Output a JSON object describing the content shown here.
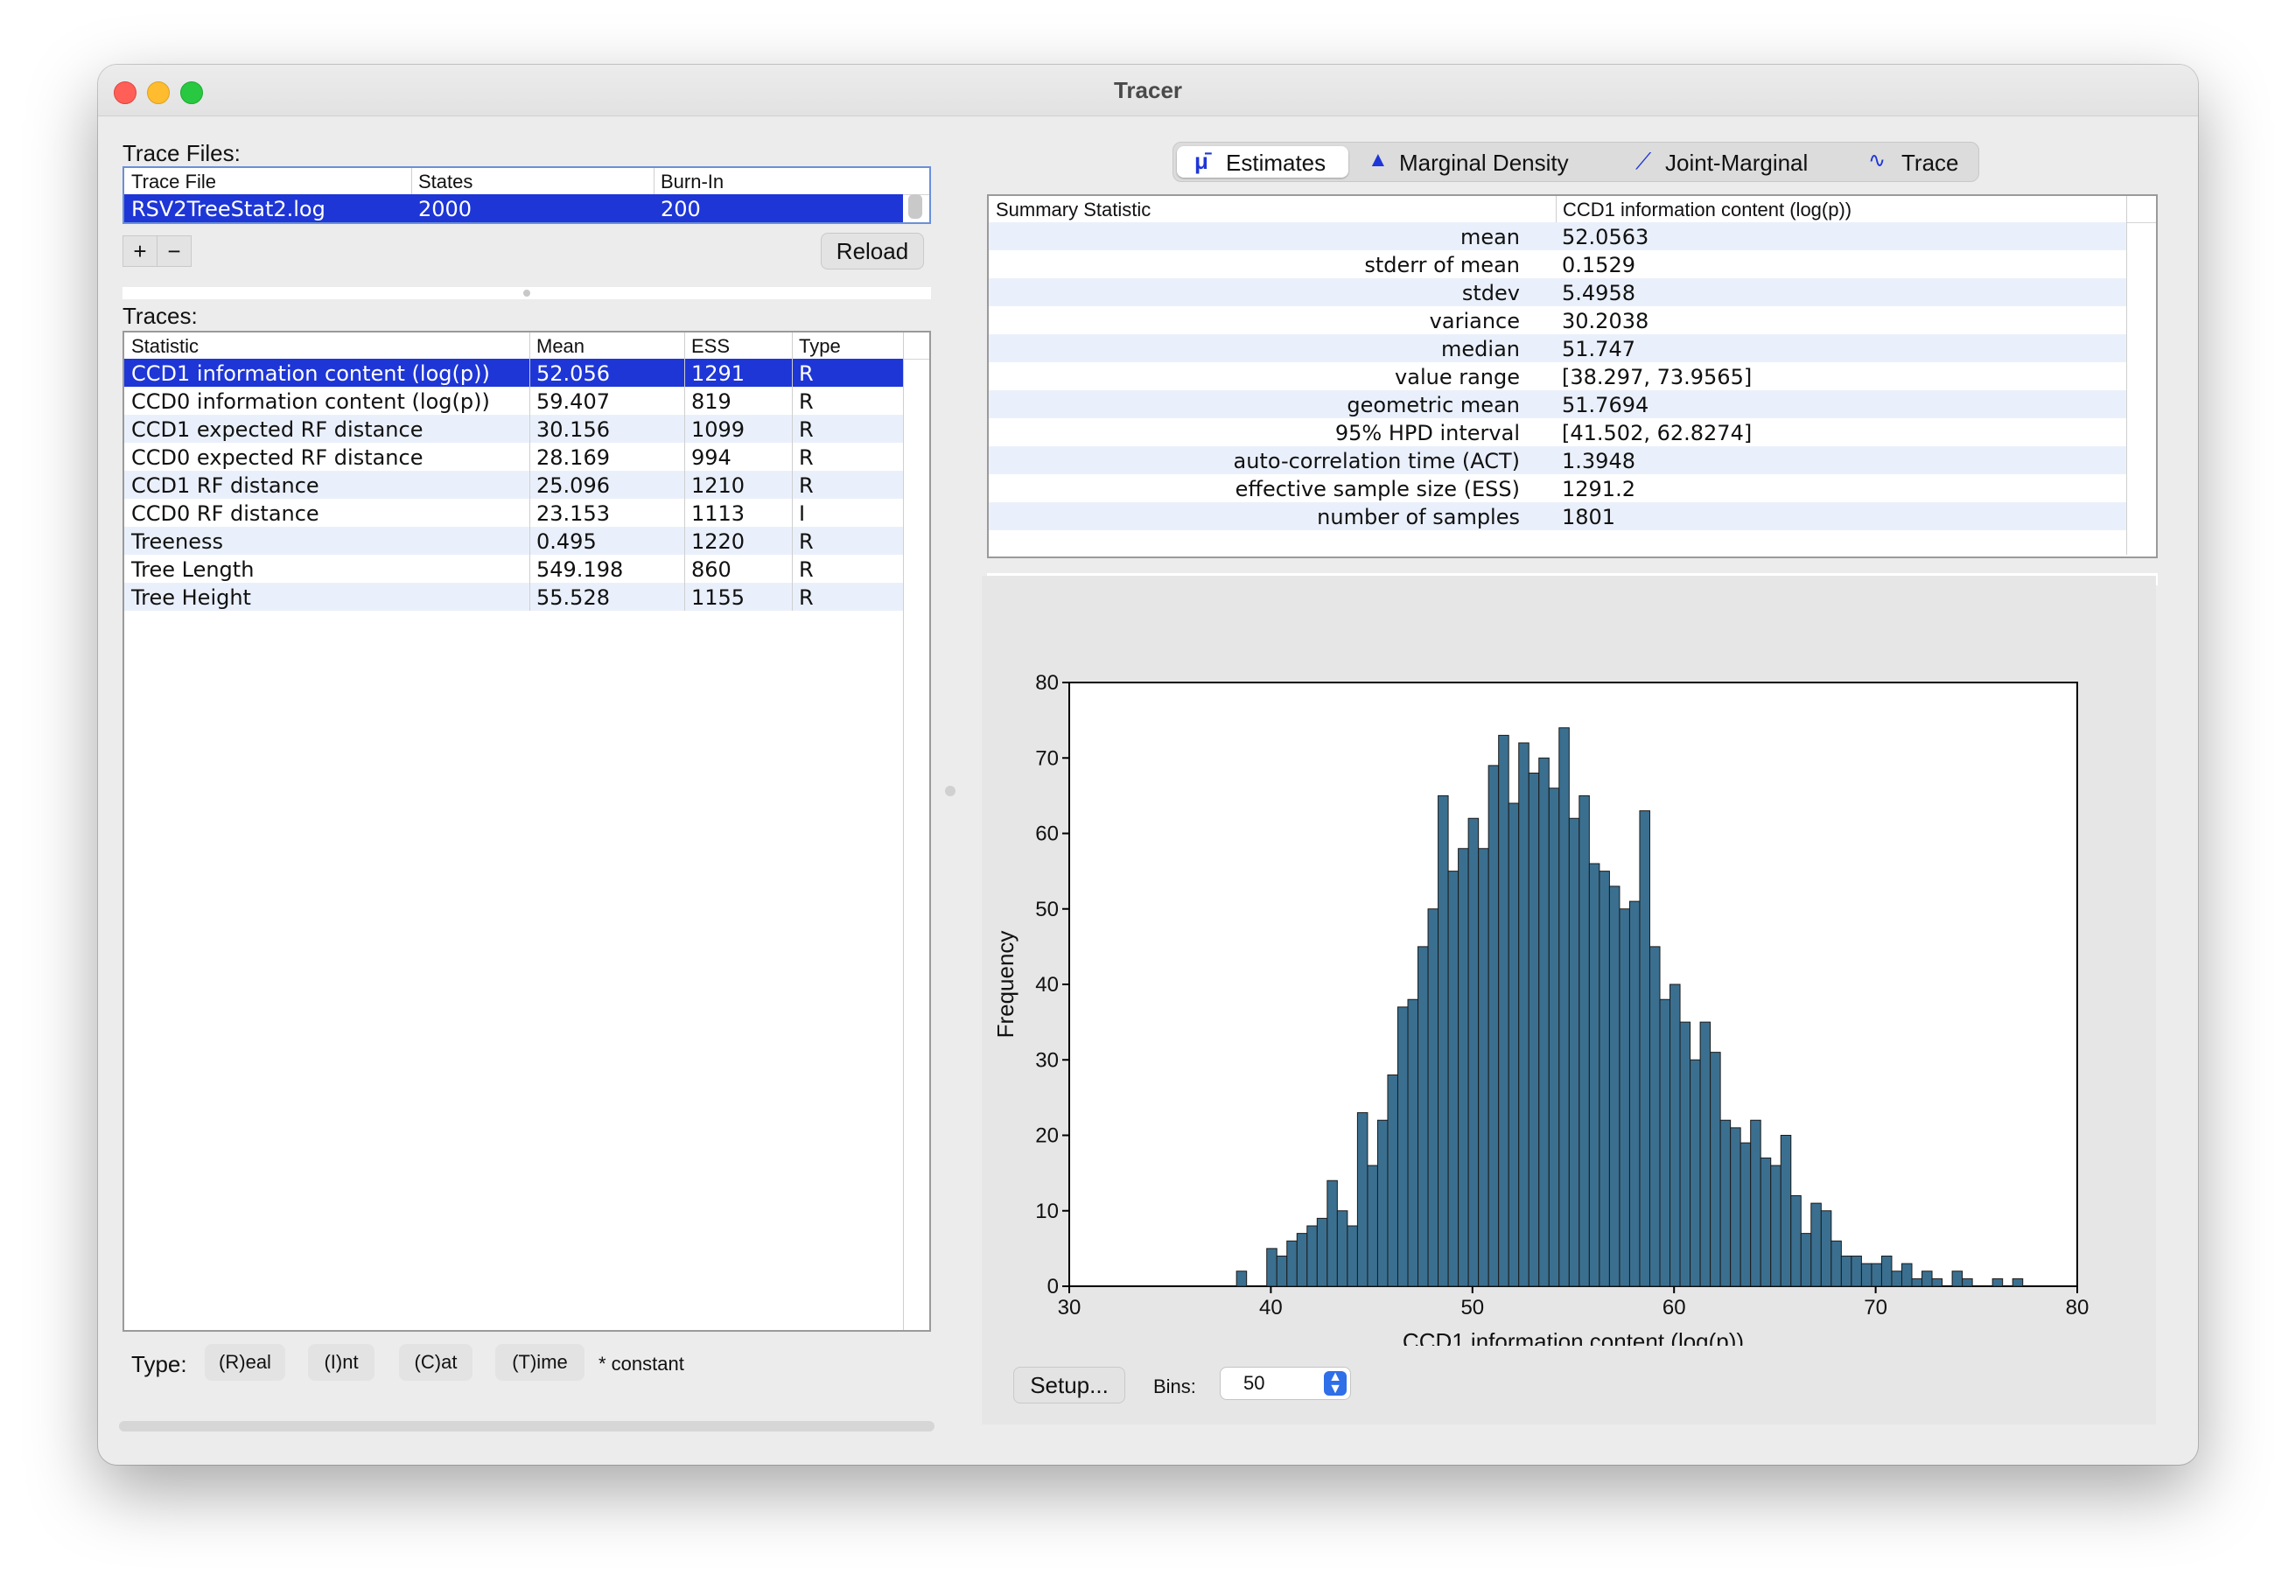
{
  "window": {
    "title": "Tracer"
  },
  "trace_files": {
    "label": "Trace Files:",
    "columns": [
      "Trace File",
      "States",
      "Burn-In"
    ],
    "rows": [
      {
        "file": "RSV2TreeStat2.log",
        "states": "2000",
        "burnin": "200"
      }
    ],
    "add_label": "+",
    "remove_label": "−",
    "reload_label": "Reload"
  },
  "traces": {
    "label": "Traces:",
    "columns": [
      "Statistic",
      "Mean",
      "ESS",
      "Type"
    ],
    "rows": [
      {
        "statistic": "CCD1 information content (log(p))",
        "mean": "52.056",
        "ess": "1291",
        "type": "R"
      },
      {
        "statistic": "CCD0 information content (log(p))",
        "mean": "59.407",
        "ess": "819",
        "type": "R"
      },
      {
        "statistic": "CCD1 expected RF distance",
        "mean": "30.156",
        "ess": "1099",
        "type": "R"
      },
      {
        "statistic": "CCD0 expected RF distance",
        "mean": "28.169",
        "ess": "994",
        "type": "R"
      },
      {
        "statistic": "CCD1 RF distance",
        "mean": "25.096",
        "ess": "1210",
        "type": "R"
      },
      {
        "statistic": "CCD0 RF distance",
        "mean": "23.153",
        "ess": "1113",
        "type": "I"
      },
      {
        "statistic": "Treeness",
        "mean": "0.495",
        "ess": "1220",
        "type": "R"
      },
      {
        "statistic": "Tree Length",
        "mean": "549.198",
        "ess": "860",
        "type": "R"
      },
      {
        "statistic": "Tree Height",
        "mean": "55.528",
        "ess": "1155",
        "type": "R"
      }
    ]
  },
  "type_bar": {
    "label": "Type:",
    "real": "(R)eal",
    "int": "(I)nt",
    "cat": "(C)at",
    "time": "(T)ime",
    "constant_note": "* constant"
  },
  "tabs": [
    {
      "label": "Estimates",
      "icon": "mu-icon"
    },
    {
      "label": "Marginal Density",
      "icon": "density-icon"
    },
    {
      "label": "Joint-Marginal",
      "icon": "scatter-icon"
    },
    {
      "label": "Trace",
      "icon": "trace-icon"
    }
  ],
  "summary": {
    "col_statistic": "Summary Statistic",
    "col_value": "CCD1 information content (log(p))",
    "rows": [
      {
        "key": "mean",
        "value": "52.0563"
      },
      {
        "key": "stderr of mean",
        "value": "0.1529"
      },
      {
        "key": "stdev",
        "value": "5.4958"
      },
      {
        "key": "variance",
        "value": "30.2038"
      },
      {
        "key": "median",
        "value": "51.747"
      },
      {
        "key": "value range",
        "value": "[38.297, 73.9565]"
      },
      {
        "key": "geometric mean",
        "value": "51.7694"
      },
      {
        "key": "95% HPD interval",
        "value": "[41.502, 62.8274]"
      },
      {
        "key": "auto-correlation time (ACT)",
        "value": "1.3948"
      },
      {
        "key": "effective sample size (ESS)",
        "value": "1291.2"
      },
      {
        "key": "number of samples",
        "value": "1801"
      }
    ]
  },
  "controls": {
    "setup_label": "Setup...",
    "bins_label": "Bins:",
    "bins_value": "50"
  },
  "chart_data": {
    "type": "bar",
    "xlabel": "CCD1 information content (log(p))",
    "ylabel": "Frequency",
    "xlim": [
      30,
      80
    ],
    "ylim": [
      0,
      80
    ],
    "xticks": [
      30,
      40,
      50,
      60,
      70,
      80
    ],
    "yticks": [
      0,
      10,
      20,
      30,
      40,
      50,
      60,
      70,
      80
    ],
    "bar_color": "#3b6f8f",
    "bin_start": 38.297,
    "bin_width": 0.5,
    "values": [
      2,
      0,
      0,
      5,
      4,
      6,
      7,
      8,
      9,
      14,
      10,
      8,
      23,
      16,
      22,
      28,
      37,
      38,
      45,
      50,
      65,
      55,
      58,
      62,
      58,
      69,
      73,
      64,
      72,
      68,
      70,
      66,
      74,
      62,
      65,
      56,
      55,
      53,
      50,
      51,
      63,
      45,
      38,
      40,
      35,
      30,
      35,
      31,
      22,
      21,
      19,
      22,
      17,
      16,
      20,
      12,
      7,
      11,
      10,
      6,
      4,
      4,
      3,
      3,
      4,
      2,
      3,
      1,
      2,
      1,
      0,
      2,
      1,
      0,
      0,
      1,
      0,
      1
    ]
  }
}
